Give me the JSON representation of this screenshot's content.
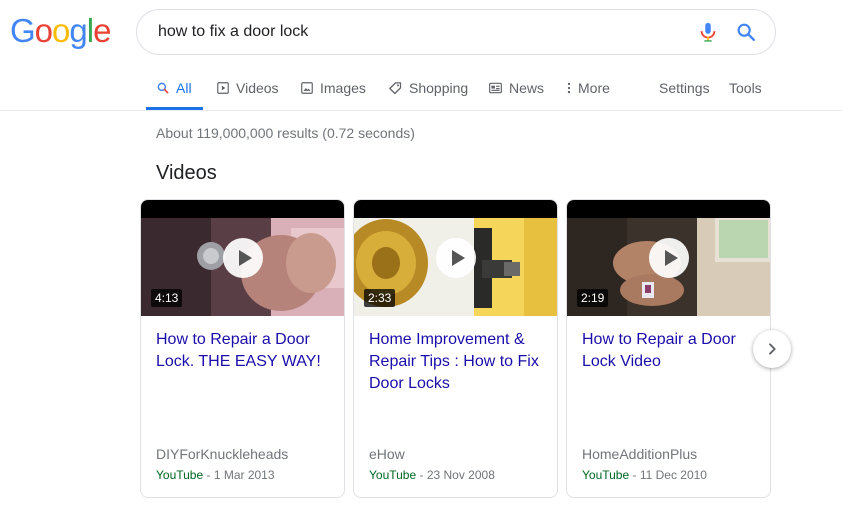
{
  "logo": {
    "letters": [
      {
        "char": "G",
        "color": "#4285f4"
      },
      {
        "char": "o",
        "color": "#ea4335"
      },
      {
        "char": "o",
        "color": "#fbbc05"
      },
      {
        "char": "g",
        "color": "#4285f4"
      },
      {
        "char": "l",
        "color": "#34a853"
      },
      {
        "char": "e",
        "color": "#ea4335"
      }
    ]
  },
  "search": {
    "query": "how to fix a door lock"
  },
  "tabs": {
    "all": "All",
    "videos": "Videos",
    "images": "Images",
    "shopping": "Shopping",
    "news": "News",
    "more": "More",
    "settings": "Settings",
    "tools": "Tools"
  },
  "results": {
    "stats": "About 119,000,000 results (0.72 seconds)"
  },
  "videos": {
    "title": "Videos",
    "cards": [
      {
        "duration": "4:13",
        "title": "How to Repair a Door Lock. THE EASY WAY!",
        "source": "DIYForKnuckleheads",
        "platform": "YouTube",
        "date": " - 1 Mar 2013"
      },
      {
        "duration": "2:33",
        "title": "Home Improvement & Repair Tips : How to Fix Door Locks",
        "source": "eHow",
        "platform": "YouTube",
        "date": " - 23 Nov 2008"
      },
      {
        "duration": "2:19",
        "title": "How to Repair a Door Lock Video",
        "source": "HomeAdditionPlus",
        "platform": "YouTube",
        "date": " - 11 Dec 2010"
      }
    ]
  },
  "colors": {
    "link": "#1a0dab",
    "accent": "#1a73e8",
    "url_green": "#006621",
    "muted": "#70757a"
  }
}
